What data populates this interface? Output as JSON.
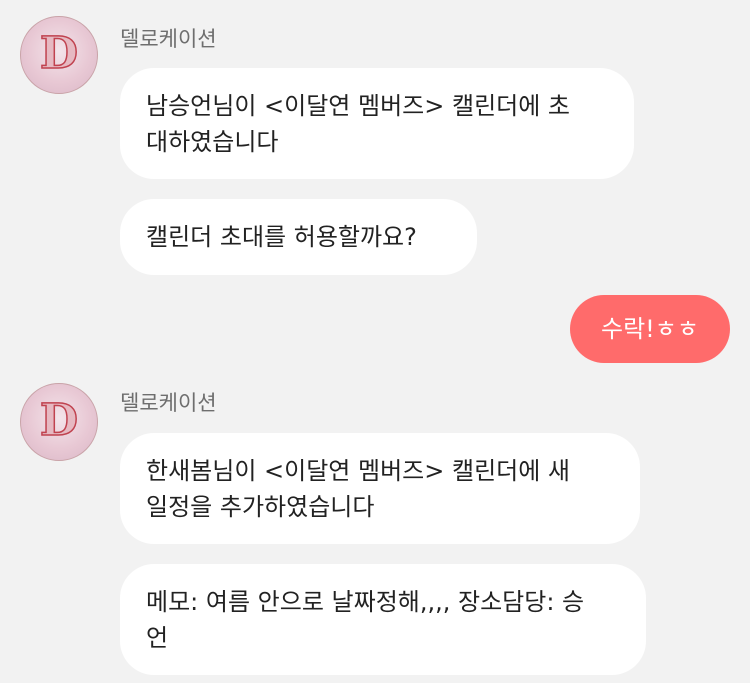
{
  "messages": [
    {
      "sender": "델로케이션",
      "avatar_letter": "D",
      "bubbles": [
        {
          "lines": [
            "남승언님이 <이달연 멤버즈> 캘린더에 초",
            "대하였습니다"
          ]
        },
        {
          "lines": [
            "캘린더 초대를 허용할까요?"
          ]
        }
      ]
    },
    {
      "mine": true,
      "text": "수락!ㅎㅎ"
    },
    {
      "sender": "델로케이션",
      "avatar_letter": "D",
      "bubbles": [
        {
          "lines": [
            "한새봄님이 <이달연 멤버즈> 캘린더에 새",
            "일정을 추가하였습니다"
          ]
        },
        {
          "lines": [
            "메모: 여름 안으로 날짜정해,,,, 장소담당: 승",
            "언"
          ]
        }
      ]
    }
  ],
  "colors": {
    "background": "#f2f2f2",
    "bubble_incoming": "#ffffff",
    "bubble_outgoing": "#ff6b6b",
    "sender_text": "#6e6e6e"
  },
  "icons": {
    "avatar": "delocation-logo-avatar"
  }
}
